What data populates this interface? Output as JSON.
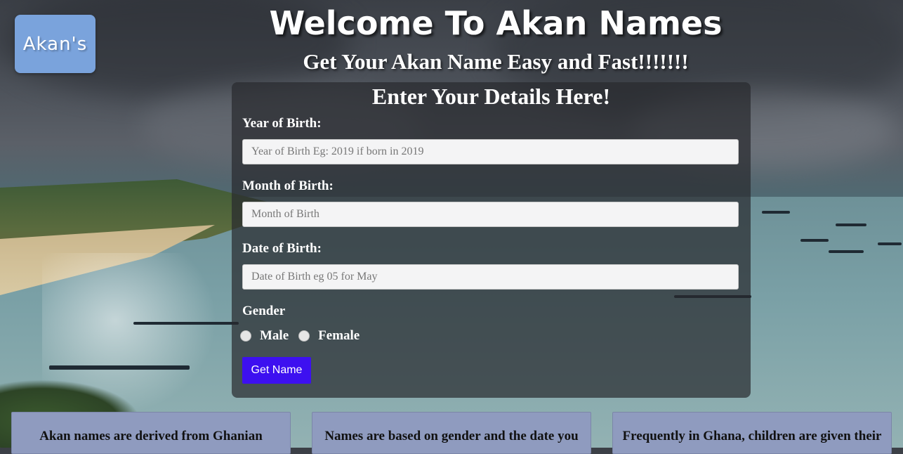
{
  "logo": {
    "text": "Akan's"
  },
  "header": {
    "title": "Welcome To Akan Names",
    "subtitle": "Get Your Akan Name Easy and Fast!!!!!!!"
  },
  "form": {
    "heading": "Enter Your Details Here!",
    "year": {
      "label": "Year of Birth:",
      "placeholder": "Year of Birth Eg: 2019 if born in 2019",
      "value": ""
    },
    "month": {
      "label": "Month of Birth:",
      "placeholder": "Month of Birth",
      "value": ""
    },
    "date": {
      "label": "Date of Birth:",
      "placeholder": "Date of Birth eg 05 for May",
      "value": ""
    },
    "gender": {
      "label": "Gender",
      "options": [
        "Male",
        "Female"
      ],
      "selected": null
    },
    "submit_label": "Get Name"
  },
  "cards": [
    {
      "text": "Akan names are derived from Ghanian"
    },
    {
      "text": "Names are based on gender and the date you"
    },
    {
      "text": "Frequently in Ghana, children are given their"
    }
  ],
  "colors": {
    "button": "#3d10f0",
    "logo": "#7aa3dc",
    "card": "#8f9bbf"
  }
}
